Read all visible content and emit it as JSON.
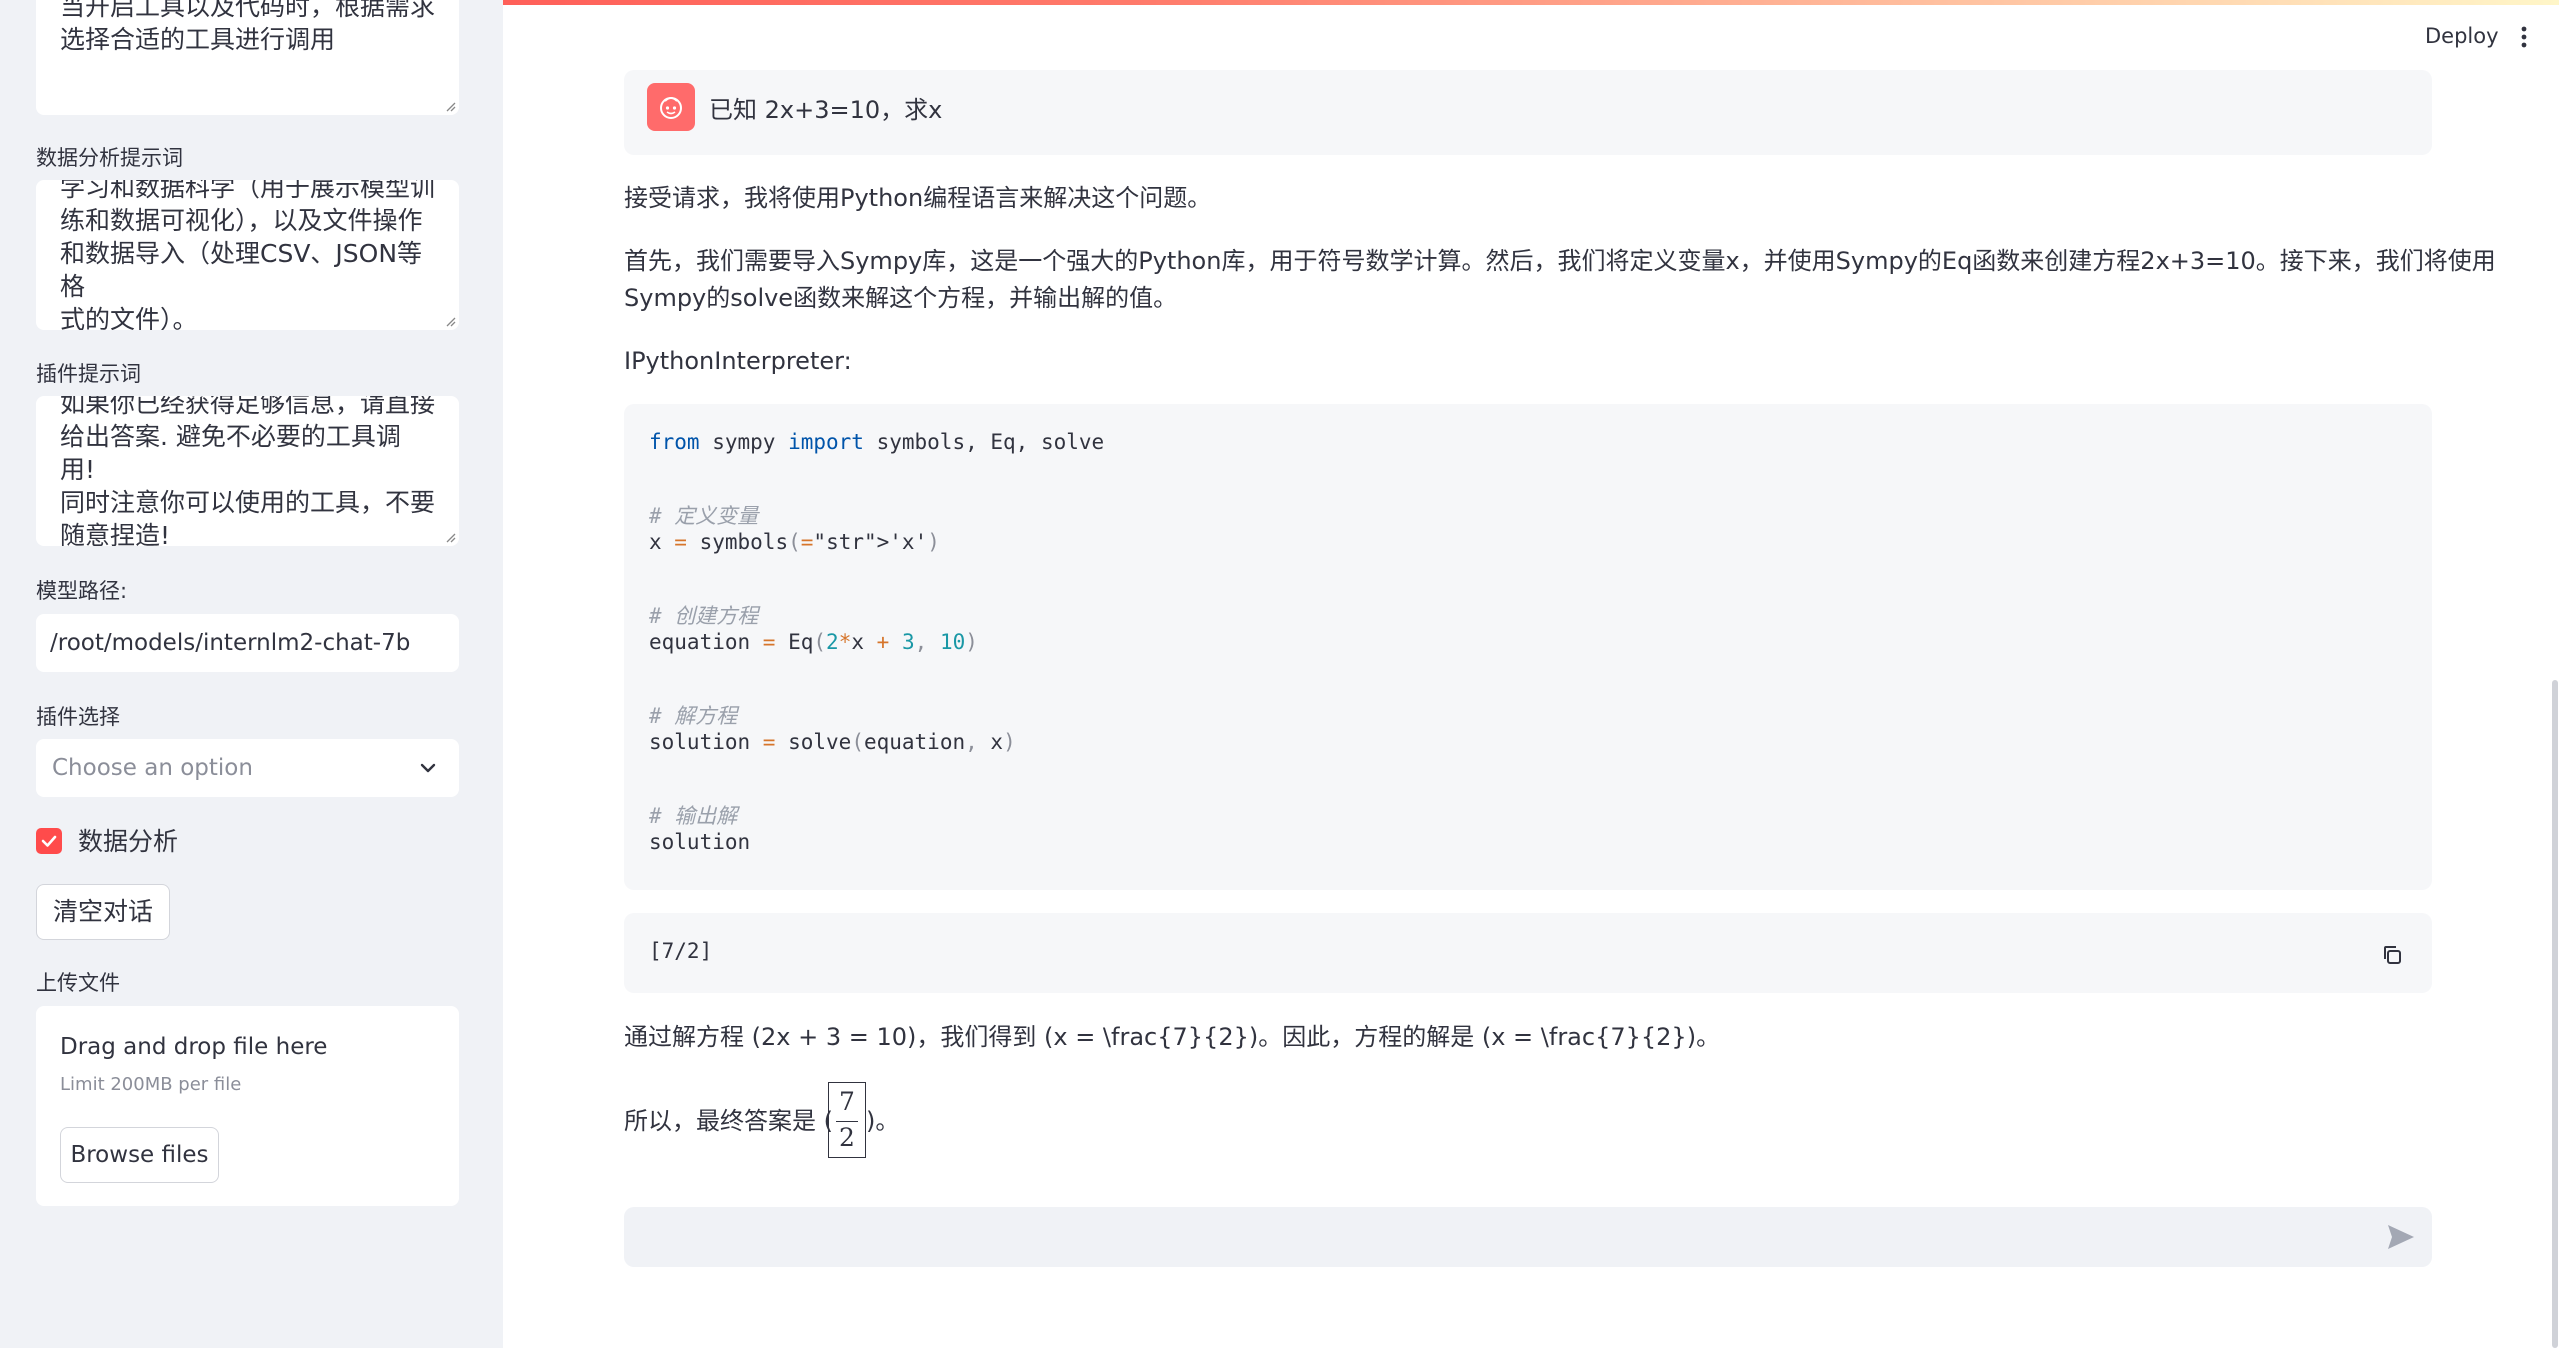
{
  "sidebar": {
    "system_prompt_tail": [
      "当开启工具以及代码时，根据需求",
      "选择合适的工具进行调用"
    ],
    "data_analysis_label": "数据分析提示词",
    "data_analysis_text": [
      "学习和数据科学（用于展示模型训",
      "练和数据可视化），以及文件操作",
      "和数据导入（处理CSV、JSON等格",
      "式的文件）。"
    ],
    "plugin_prompt_label": "插件提示词",
    "plugin_prompt_text": [
      "如果你已经获得足够信息，请直接",
      "给出答案. 避免不必要的工具调用!",
      "同时注意你可以使用的工具，不要",
      "随意捏造!"
    ],
    "model_path_label": "模型路径:",
    "model_path_value": "/root/models/internlm2-chat-7b",
    "plugin_select_label": "插件选择",
    "plugin_select_placeholder": "Choose an option",
    "data_analysis_checkbox_label": "数据分析",
    "data_analysis_checked": true,
    "clear_button": "清空对话",
    "upload_label": "上传文件",
    "upload_drag": "Drag and drop file here",
    "upload_limit": "Limit 200MB per file",
    "upload_button": "Browse files"
  },
  "header": {
    "deploy": "Deploy"
  },
  "chat": {
    "user_message": "已知 2x+3=10，求x",
    "assistant": {
      "intro": "接受请求，我将使用Python编程语言来解决这个问题。",
      "explain_line1": "首先，我们需要导入Sympy库，这是一个强大的Python库，用于符号数学计算。然后，我们将定义变量x，并使用Sympy的Eq函数来创建方程2x+3=10。接下来，我们将使用",
      "explain_line2": "Sympy的solve函数来解这个方程，并输出解的值。",
      "tool_name": "IPythonInterpreter:",
      "code": {
        "import_from": "from",
        "import_module": " sympy ",
        "import_kw": "import",
        "import_names": " symbols, Eq, solve",
        "comment_define": "# 定义变量",
        "line_x": "x = symbols('x')",
        "comment_create": "# 创建方程",
        "line_eq": "equation = Eq(2*x + 3, 10)",
        "comment_solve": "# 解方程",
        "line_solve": "solution = solve(equation, x)",
        "comment_output": "# 输出解",
        "line_output": "solution"
      },
      "output": "[7/2]",
      "result_line": "通过解方程 (2x + 3 = 10)，我们得到 (x = \\frac{7}{2})。因此，方程的解是 (x = \\frac{7}{2})。",
      "final_prefix": "所以，最终答案是 (",
      "final_numerator": "7",
      "final_denominator": "2",
      "final_suffix": ")。"
    },
    "input_placeholder": ""
  },
  "colors": {
    "accent": "#ff4b4b",
    "sidebar_bg": "#f0f2f6",
    "code_bg": "#f6f7f9",
    "text": "#31333f"
  },
  "icons": [
    "robot-avatar-icon",
    "chevron-down-icon",
    "check-icon",
    "copy-icon",
    "send-icon",
    "kebab-menu-icon",
    "resize-grip-icon"
  ]
}
